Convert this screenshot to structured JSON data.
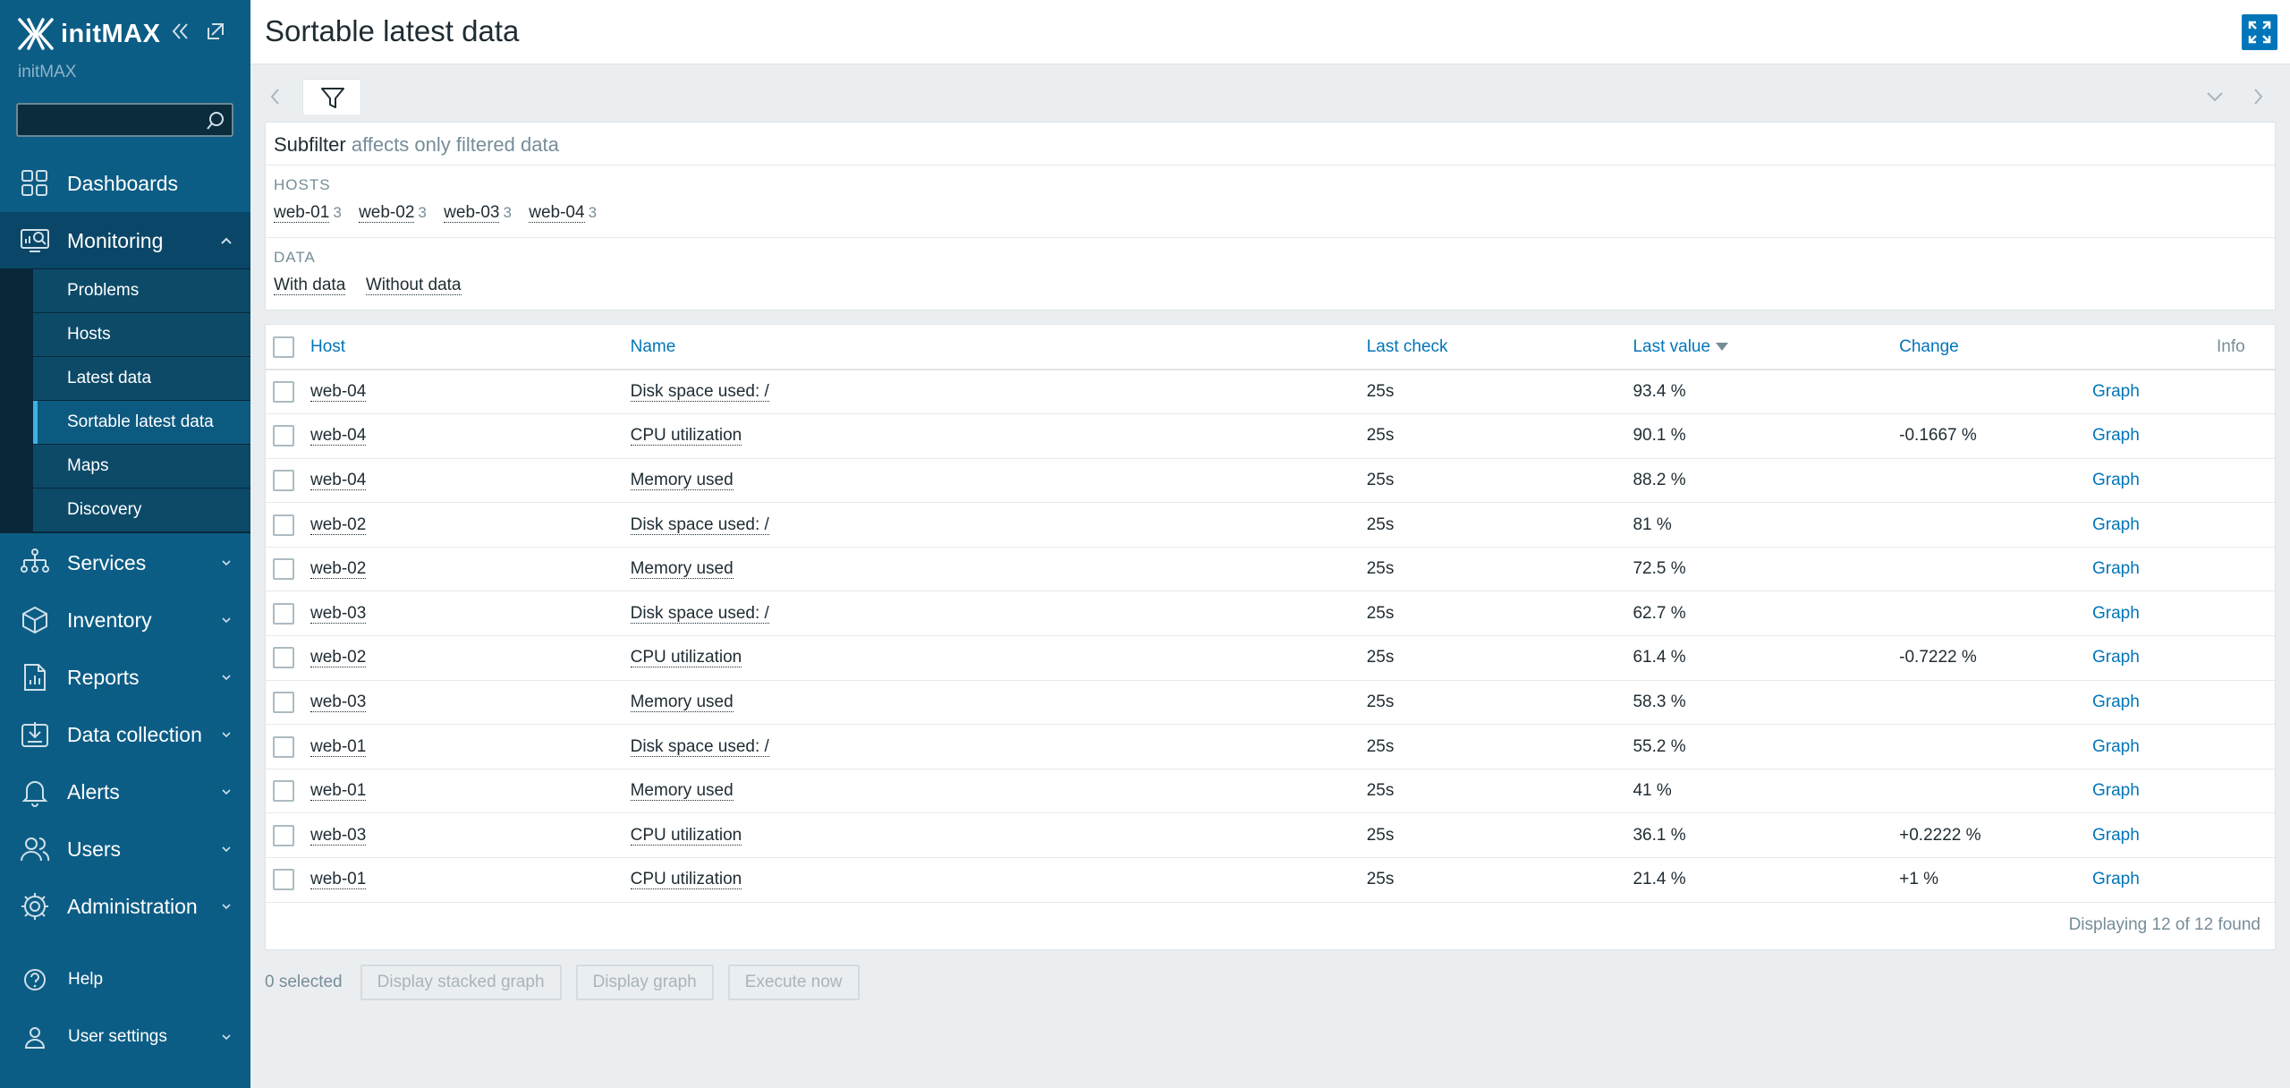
{
  "sidebar": {
    "logo_text": "initMAX",
    "server_name": "initMAX",
    "search": {
      "value": "",
      "placeholder": ""
    },
    "menu": [
      {
        "label": "Dashboards",
        "icon": "dashboards-icon"
      },
      {
        "label": "Monitoring",
        "icon": "monitoring-icon",
        "open": true
      },
      {
        "label": "Services",
        "icon": "services-icon"
      },
      {
        "label": "Inventory",
        "icon": "inventory-icon"
      },
      {
        "label": "Reports",
        "icon": "reports-icon"
      },
      {
        "label": "Data collection",
        "icon": "data-collection-icon"
      },
      {
        "label": "Alerts",
        "icon": "alerts-icon"
      },
      {
        "label": "Users",
        "icon": "users-icon"
      },
      {
        "label": "Administration",
        "icon": "administration-icon"
      }
    ],
    "monitoring_submenu": [
      {
        "label": "Problems"
      },
      {
        "label": "Hosts"
      },
      {
        "label": "Latest data"
      },
      {
        "label": "Sortable latest data",
        "active": true
      },
      {
        "label": "Maps"
      },
      {
        "label": "Discovery"
      }
    ],
    "bottom": [
      {
        "label": "Help",
        "icon": "help-icon"
      },
      {
        "label": "User settings",
        "icon": "user-settings-icon"
      }
    ]
  },
  "header": {
    "title": "Sortable latest data"
  },
  "subfilter": {
    "title": "Subfilter",
    "note": "affects only filtered data",
    "hosts_label": "HOSTS",
    "hosts": [
      {
        "name": "web-01",
        "count": "3"
      },
      {
        "name": "web-02",
        "count": "3"
      },
      {
        "name": "web-03",
        "count": "3"
      },
      {
        "name": "web-04",
        "count": "3"
      }
    ],
    "data_label": "DATA",
    "data_options": [
      "With data",
      "Without data"
    ]
  },
  "table": {
    "columns": {
      "host": "Host",
      "name": "Name",
      "last_check": "Last check",
      "last_value": "Last value",
      "change": "Change",
      "info": "Info"
    },
    "rows": [
      {
        "host": "web-04",
        "name": "Disk space used: /",
        "last_check": "25s",
        "last_value": "93.4 %",
        "change": "",
        "graph": "Graph"
      },
      {
        "host": "web-04",
        "name": "CPU utilization",
        "last_check": "25s",
        "last_value": "90.1 %",
        "change": "-0.1667 %",
        "graph": "Graph"
      },
      {
        "host": "web-04",
        "name": "Memory used",
        "last_check": "25s",
        "last_value": "88.2 %",
        "change": "",
        "graph": "Graph"
      },
      {
        "host": "web-02",
        "name": "Disk space used: /",
        "last_check": "25s",
        "last_value": "81 %",
        "change": "",
        "graph": "Graph"
      },
      {
        "host": "web-02",
        "name": "Memory used",
        "last_check": "25s",
        "last_value": "72.5 %",
        "change": "",
        "graph": "Graph"
      },
      {
        "host": "web-03",
        "name": "Disk space used: /",
        "last_check": "25s",
        "last_value": "62.7 %",
        "change": "",
        "graph": "Graph"
      },
      {
        "host": "web-02",
        "name": "CPU utilization",
        "last_check": "25s",
        "last_value": "61.4 %",
        "change": "-0.7222 %",
        "graph": "Graph"
      },
      {
        "host": "web-03",
        "name": "Memory used",
        "last_check": "25s",
        "last_value": "58.3 %",
        "change": "",
        "graph": "Graph"
      },
      {
        "host": "web-01",
        "name": "Disk space used: /",
        "last_check": "25s",
        "last_value": "55.2 %",
        "change": "",
        "graph": "Graph"
      },
      {
        "host": "web-01",
        "name": "Memory used",
        "last_check": "25s",
        "last_value": "41 %",
        "change": "",
        "graph": "Graph"
      },
      {
        "host": "web-03",
        "name": "CPU utilization",
        "last_check": "25s",
        "last_value": "36.1 %",
        "change": "+0.2222 %",
        "graph": "Graph"
      },
      {
        "host": "web-01",
        "name": "CPU utilization",
        "last_check": "25s",
        "last_value": "21.4 %",
        "change": "+1 %",
        "graph": "Graph"
      }
    ],
    "footer": "Displaying 12 of 12 found"
  },
  "actions": {
    "selected": "0 selected",
    "buttons": [
      "Display stacked graph",
      "Display graph",
      "Execute now"
    ]
  },
  "colors": {
    "sidebar_bg": "#0c5d85",
    "accent": "#0275b8",
    "page_bg": "#ebeef0"
  }
}
